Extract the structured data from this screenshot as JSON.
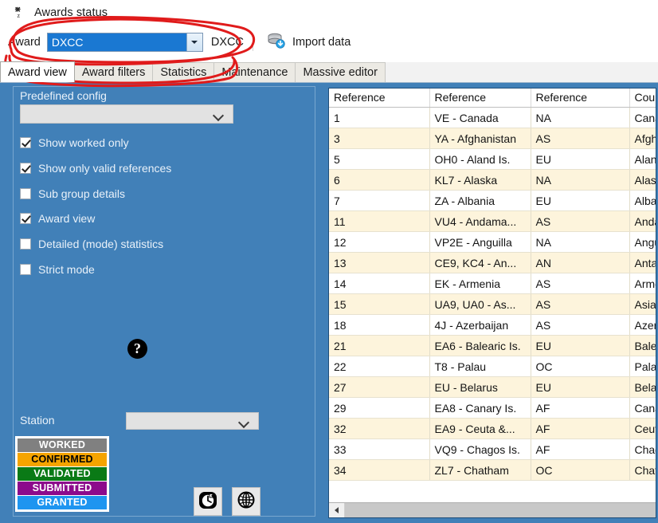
{
  "window": {
    "title": "Awards status",
    "icon": "awards-status-icon"
  },
  "toolbar": {
    "award_label": "Award",
    "award_combo_value": "DXCC",
    "award_code": "DXCC",
    "import_label": "Import data",
    "import_icon": "import-data-icon",
    "dropdown_icon": "chevron-down-icon"
  },
  "tabs": [
    {
      "label": "Award view",
      "active": true
    },
    {
      "label": "Award filters",
      "active": false
    },
    {
      "label": "Statistics",
      "active": false
    },
    {
      "label": "Maintenance",
      "active": false
    },
    {
      "label": "Massive editor",
      "active": false
    }
  ],
  "config_panel": {
    "title": "Predefined config",
    "predefined_config_value": "",
    "checkboxes": [
      {
        "label": "Show worked only",
        "checked": true
      },
      {
        "label": "Show only valid references",
        "checked": true
      },
      {
        "label": "Sub group details",
        "checked": false
      },
      {
        "label": "Award view",
        "checked": true
      },
      {
        "label": "Detailed (mode) statistics",
        "checked": false
      },
      {
        "label": "Strict mode",
        "checked": false
      }
    ],
    "help_icon": "question-mark-icon",
    "help_glyph": "?",
    "station_label": "Station",
    "station_value": "",
    "legend": [
      {
        "label": "WORKED",
        "bg": "#808080",
        "fg": "#ffffff"
      },
      {
        "label": "CONFIRMED",
        "bg": "#f5a400",
        "fg": "#000000"
      },
      {
        "label": "VALIDATED",
        "bg": "#0a7a16",
        "fg": "#ffffff"
      },
      {
        "label": "SUBMITTED",
        "bg": "#8c0a8c",
        "fg": "#ffffff"
      },
      {
        "label": "GRANTED",
        "bg": "#1e95f0",
        "fg": "#ffffff"
      }
    ],
    "buttons": [
      {
        "name": "clock-button",
        "icon": "clock-icon"
      },
      {
        "name": "globe-button",
        "icon": "globe-icon"
      }
    ]
  },
  "grid": {
    "columns": [
      "Reference",
      "Reference",
      "Reference",
      "Cou"
    ],
    "rows": [
      {
        "cells": [
          "1",
          "VE - Canada",
          "NA",
          "Cana"
        ]
      },
      {
        "cells": [
          "3",
          "YA - Afghanistan",
          "AS",
          "Afgh"
        ]
      },
      {
        "cells": [
          "5",
          "OH0 - Aland Is.",
          "EU",
          "Aland"
        ]
      },
      {
        "cells": [
          "6",
          "KL7 - Alaska",
          "NA",
          "Alask"
        ]
      },
      {
        "cells": [
          "7",
          "ZA - Albania",
          "EU",
          "Alban"
        ]
      },
      {
        "cells": [
          "11",
          "VU4 - Andama...",
          "AS",
          "Anda"
        ]
      },
      {
        "cells": [
          "12",
          "VP2E - Anguilla",
          "NA",
          "Angu"
        ]
      },
      {
        "cells": [
          "13",
          "CE9, KC4 - An...",
          "AN",
          "Anta"
        ]
      },
      {
        "cells": [
          "14",
          "EK - Armenia",
          "AS",
          "Arme"
        ]
      },
      {
        "cells": [
          "15",
          "UA9, UA0 - As...",
          "AS",
          "Asiat"
        ]
      },
      {
        "cells": [
          "18",
          "4J - Azerbaijan",
          "AS",
          "Azerb"
        ]
      },
      {
        "cells": [
          "21",
          "EA6 - Balearic Is.",
          "EU",
          "Balea"
        ]
      },
      {
        "cells": [
          "22",
          "T8 - Palau",
          "OC",
          "Palau"
        ]
      },
      {
        "cells": [
          "27",
          "EU - Belarus",
          "EU",
          "Belar"
        ]
      },
      {
        "cells": [
          "29",
          "EA8 - Canary Is.",
          "AF",
          "Cana"
        ]
      },
      {
        "cells": [
          "32",
          "EA9 - Ceuta &...",
          "AF",
          "Ceut"
        ]
      },
      {
        "cells": [
          "33",
          "VQ9 - Chagos Is.",
          "AF",
          "Chag"
        ]
      },
      {
        "cells": [
          "34",
          "ZL7 - Chatham",
          "OC",
          "Chath"
        ]
      }
    ],
    "scrollbar_left_icon": "scroll-left-arrow-icon"
  },
  "annotation": {
    "color": "#e01b1b",
    "shapes": [
      "ellipse-around-award-selector",
      "ellipse-around-tabs"
    ]
  }
}
